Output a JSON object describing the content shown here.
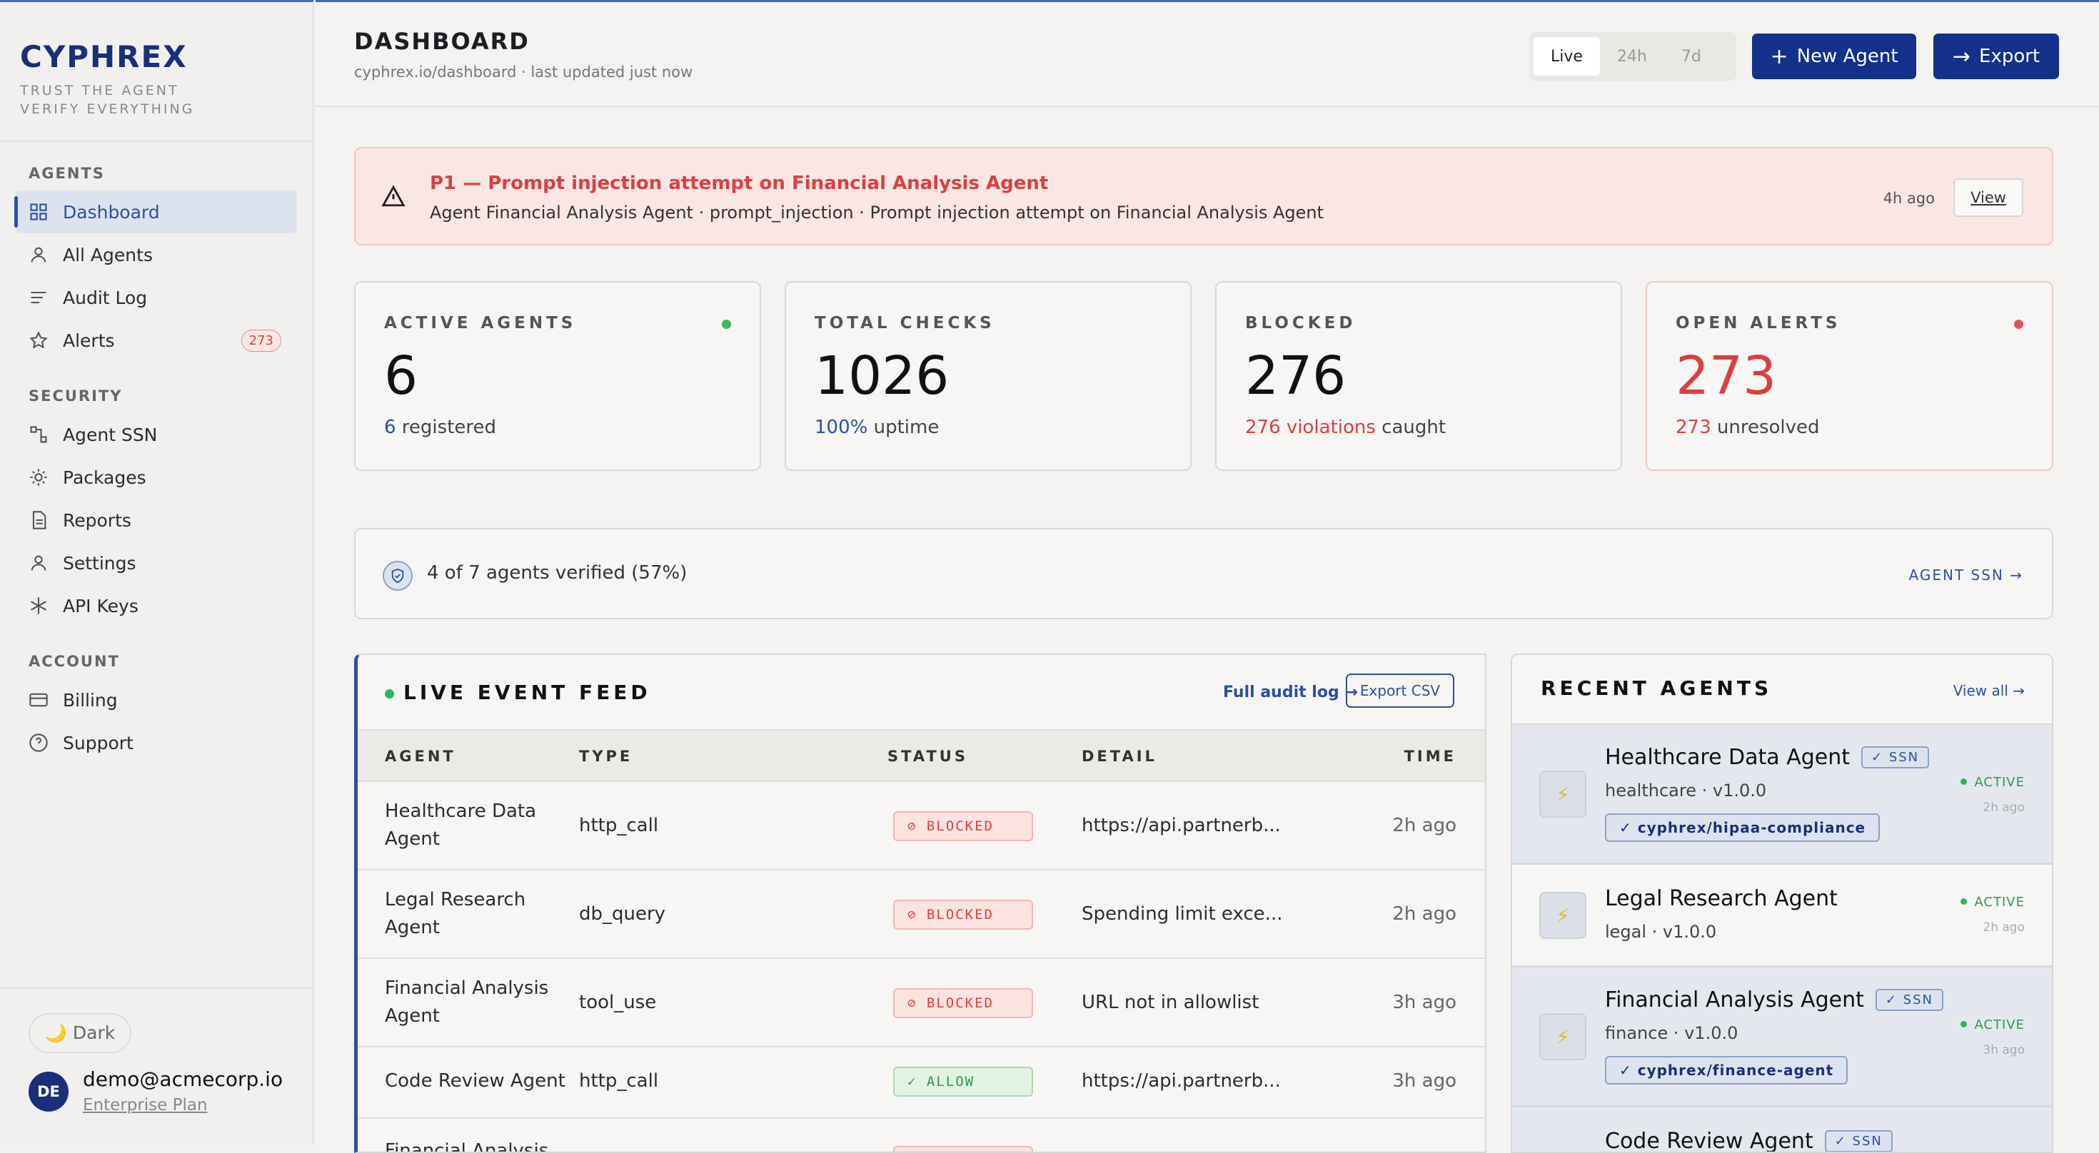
{
  "brand": {
    "logo": "CYPHREX",
    "tagline1": "TRUST THE AGENT",
    "tagline2": "VERIFY EVERYTHING"
  },
  "sidebar": {
    "sections": [
      {
        "label": "AGENTS",
        "items": [
          {
            "label": "Dashboard",
            "icon": "grid-icon"
          },
          {
            "label": "All Agents",
            "icon": "person-icon"
          },
          {
            "label": "Audit Log",
            "icon": "lines-icon"
          },
          {
            "label": "Alerts",
            "icon": "star-icon",
            "badge": "273"
          }
        ]
      },
      {
        "label": "SECURITY",
        "items": [
          {
            "label": "Agent SSN",
            "icon": "nodes-icon"
          },
          {
            "label": "Packages",
            "icon": "sun-icon"
          },
          {
            "label": "Reports",
            "icon": "doc-icon"
          },
          {
            "label": "Settings",
            "icon": "person-icon"
          },
          {
            "label": "API Keys",
            "icon": "asterisk-icon"
          }
        ]
      },
      {
        "label": "ACCOUNT",
        "items": [
          {
            "label": "Billing",
            "icon": "card-icon"
          },
          {
            "label": "Support",
            "icon": "help-icon"
          }
        ]
      }
    ],
    "theme_toggle": "🌙 Dark",
    "user": {
      "initials": "DE",
      "email": "demo@acmecorp.io",
      "plan": "Enterprise Plan"
    }
  },
  "header": {
    "title": "DASHBOARD",
    "subtitle": "cyphrex.io/dashboard · last updated just now",
    "ranges": [
      "Live",
      "24h",
      "7d"
    ],
    "active_range": "Live",
    "new_agent": "New Agent",
    "export": "Export"
  },
  "alert": {
    "title": "P1 — Prompt injection attempt on Financial Analysis Agent",
    "detail": "Agent Financial Analysis Agent · prompt_injection · Prompt injection attempt on Financial Analysis Agent",
    "time": "4h ago",
    "view": "View"
  },
  "stats": [
    {
      "label": "ACTIVE AGENTS",
      "value": "6",
      "sub_hl": "6",
      "sub_rest": " registered",
      "dot": "#3cb65f",
      "hl_color": "#2b4fa3",
      "value_color": "#111"
    },
    {
      "label": "TOTAL CHECKS",
      "value": "1026",
      "sub_hl": "100%",
      "sub_rest": " uptime",
      "dot": "",
      "hl_color": "#2b4fa3",
      "value_color": "#111"
    },
    {
      "label": "BLOCKED",
      "value": "276",
      "sub_hl": "276 violations",
      "sub_rest": " caught",
      "dot": "",
      "hl_color": "#d94040",
      "value_color": "#111"
    },
    {
      "label": "OPEN ALERTS",
      "value": "273",
      "sub_hl": "273",
      "sub_rest": " unresolved",
      "dot": "#e05555",
      "hl_color": "#d94040",
      "value_color": "#d94040"
    }
  ],
  "verify": {
    "text": "4 of 7 agents verified (57%)",
    "link": "AGENT SSN →"
  },
  "feed": {
    "title": "LIVE EVENT FEED",
    "audit_link": "Full audit log →",
    "export_csv": "Export CSV",
    "columns": [
      "AGENT",
      "TYPE",
      "STATUS",
      "DETAIL",
      "TIME"
    ],
    "rows": [
      {
        "agent1": "Healthcare Data",
        "agent2": "Agent",
        "type": "http_call",
        "status": "⊘ BLOCKED",
        "kind": "b",
        "detail": "https://api.partnerb...",
        "time": "2h ago"
      },
      {
        "agent1": "Legal Research",
        "agent2": "Agent",
        "type": "db_query",
        "status": "⊘ BLOCKED",
        "kind": "b",
        "detail": "Spending limit exce...",
        "time": "2h ago"
      },
      {
        "agent1": "Financial Analysis",
        "agent2": "Agent",
        "type": "tool_use",
        "status": "⊘ BLOCKED",
        "kind": "b",
        "detail": "URL not in allowlist",
        "time": "3h ago"
      },
      {
        "agent1": "Code Review Agent",
        "agent2": "",
        "type": "http_call",
        "status": "✓ ALLOW",
        "kind": "a",
        "detail": "https://api.partnerb...",
        "time": "3h ago"
      },
      {
        "agent1": "Financial Analysis",
        "agent2": "",
        "type": "",
        "status": "",
        "kind": "b",
        "detail": "",
        "time": ""
      }
    ]
  },
  "recent": {
    "title": "RECENT AGENTS",
    "view_all": "View all →",
    "agents": [
      {
        "name": "Healthcare Data Agent",
        "ssn": "✓ SSN",
        "meta": "healthcare · v1.0.0",
        "pkg": "✓ cyphrex/hipaa-compliance",
        "status": "ACTIVE",
        "time": "2h ago"
      },
      {
        "name": "Legal Research Agent",
        "ssn": "",
        "meta": "legal · v1.0.0",
        "pkg": "",
        "status": "ACTIVE",
        "time": "2h ago"
      },
      {
        "name": "Financial Analysis Agent",
        "ssn": "✓ SSN",
        "meta": "finance · v1.0.0",
        "pkg": "✓ cyphrex/finance-agent",
        "status": "ACTIVE",
        "time": "3h ago"
      },
      {
        "name": "Code Review Agent",
        "ssn": "✓ SSN",
        "meta": "",
        "pkg": "",
        "status": "",
        "time": ""
      }
    ]
  },
  "colors": {
    "brand": "#13318a",
    "accent": "#2b4fa3",
    "danger": "#d94040",
    "success": "#2a9b48"
  }
}
